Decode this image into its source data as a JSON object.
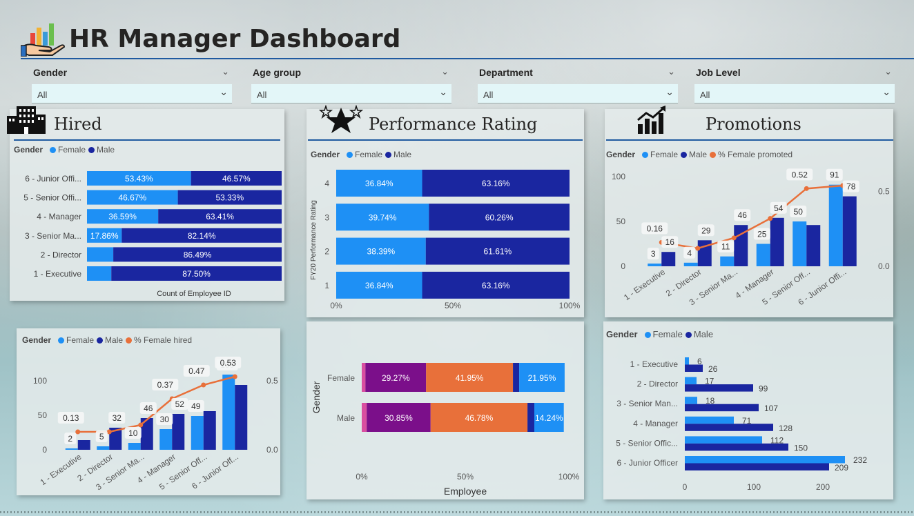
{
  "header": {
    "title": "HR Manager Dashboard"
  },
  "slicers": [
    {
      "label": "Gender",
      "value": "All"
    },
    {
      "label": "Age group",
      "value": "All"
    },
    {
      "label": "Department",
      "value": "All"
    },
    {
      "label": "Job Level",
      "value": "All"
    }
  ],
  "legend": {
    "gender": "Gender",
    "female": "Female",
    "male": "Male",
    "female_hired": "% Female hired",
    "female_promoted": "% Female promoted"
  },
  "colors": {
    "female": "#1e90f5",
    "male": "#1a26a0",
    "line": "#e8703a",
    "accent_rule": "#1f5aa0",
    "purple": "#7b0f8a",
    "pink": "#d94fa0"
  },
  "icons": [
    "chart-hand-icon",
    "building-icon",
    "stars-icon",
    "growth-chart-icon"
  ],
  "hired": {
    "title": "Hired",
    "xlabel": "Count of Employee ID"
  },
  "performance": {
    "title": "Performance Rating"
  },
  "promotions": {
    "title": "Promotions"
  },
  "chart_data": [
    {
      "id": "hired-stacked",
      "type": "bar",
      "orientation": "horizontal-100-stacked",
      "categories": [
        "6 - Junior Offi...",
        "5 - Senior Offi...",
        "4 - Manager",
        "3 - Senior Ma...",
        "2 - Director",
        "1 - Executive"
      ],
      "series": [
        {
          "name": "Female",
          "values": [
            53.43,
            46.67,
            36.59,
            17.86,
            13.51,
            12.5
          ],
          "labels": [
            "53.43%",
            "46.67%",
            "36.59%",
            "17.86%",
            "",
            ""
          ]
        },
        {
          "name": "Male",
          "values": [
            46.57,
            53.33,
            63.41,
            82.14,
            86.49,
            87.5
          ],
          "labels": [
            "46.57%",
            "53.33%",
            "63.41%",
            "82.14%",
            "86.49%",
            "87.50%"
          ]
        }
      ],
      "xlabel": "Count of Employee ID"
    },
    {
      "id": "hired-combo",
      "type": "bar",
      "categories": [
        "1 - Executive",
        "2 - Director",
        "3 - Senior Ma...",
        "4 - Manager",
        "5 - Senior Off...",
        "6 - Junior Off..."
      ],
      "series": [
        {
          "name": "Female",
          "values": [
            2,
            5,
            10,
            30,
            49,
            109
          ]
        },
        {
          "name": "Male",
          "values": [
            14,
            32,
            46,
            52,
            56,
            94
          ]
        },
        {
          "name": "% Female hired",
          "values": [
            0.13,
            0.13,
            0.18,
            0.37,
            0.47,
            0.53
          ],
          "axis": "right"
        }
      ],
      "value_labels": [
        {
          "series": "Female",
          "labels": [
            "2",
            "5",
            "10",
            "30",
            "49",
            "109"
          ]
        },
        {
          "series": "Male",
          "labels": [
            "",
            "32",
            "46",
            "52",
            "",
            ""
          ]
        },
        {
          "series": "% Female hired",
          "labels": [
            "0.13",
            "",
            "",
            "0.37",
            "0.47",
            "0.53"
          ]
        }
      ],
      "y_ticks": [
        "0",
        "50",
        "100"
      ],
      "y2_ticks": [
        "0.0",
        "0.5"
      ],
      "ylim": [
        0,
        130
      ],
      "y2lim": [
        0,
        0.65
      ]
    },
    {
      "id": "performance-rating",
      "type": "bar",
      "orientation": "horizontal-100-stacked",
      "categories": [
        "4",
        "3",
        "2",
        "1"
      ],
      "series": [
        {
          "name": "Female",
          "values": [
            36.84,
            39.74,
            38.39,
            36.84
          ],
          "labels": [
            "36.84%",
            "39.74%",
            "38.39%",
            "36.84%"
          ]
        },
        {
          "name": "Male",
          "values": [
            63.16,
            60.26,
            61.61,
            63.16
          ],
          "labels": [
            "63.16%",
            "60.26%",
            "61.61%",
            "63.16%"
          ]
        }
      ],
      "ylabel": "FY20 Performance Rating",
      "x_ticks": [
        "0%",
        "50%",
        "100%"
      ]
    },
    {
      "id": "employee-gender",
      "type": "bar",
      "orientation": "horizontal-100-stacked",
      "categories": [
        "Female",
        "Male"
      ],
      "series": [
        {
          "name": "Segment 1",
          "color": "#d94fa0",
          "values": [
            1.8,
            2.4
          ]
        },
        {
          "name": "Segment 2",
          "color": "#7b0f8a",
          "values": [
            29.27,
            30.85
          ],
          "labels": [
            "29.27%",
            "30.85%"
          ]
        },
        {
          "name": "Segment 3",
          "color": "#e8703a",
          "values": [
            41.95,
            46.78
          ],
          "labels": [
            "41.95%",
            "46.78%"
          ]
        },
        {
          "name": "Segment 4",
          "color": "#1a26a0",
          "values": [
            3.0,
            3.3
          ]
        },
        {
          "name": "Segment 5",
          "color": "#1e90f5",
          "values": [
            21.95,
            14.24
          ],
          "labels": [
            "21.95%",
            "14.24%"
          ]
        }
      ],
      "xlabel": "Employee",
      "ylabel": "Gender",
      "x_ticks": [
        "0%",
        "50%",
        "100%"
      ]
    },
    {
      "id": "promotions-combo",
      "type": "bar",
      "categories": [
        "1 - Executive",
        "2 - Director",
        "3 - Senior Ma...",
        "4 - Manager",
        "5 - Senior Off...",
        "6 - Junior Offi..."
      ],
      "series": [
        {
          "name": "Female",
          "values": [
            3,
            4,
            11,
            25,
            50,
            91
          ]
        },
        {
          "name": "Male",
          "values": [
            16,
            29,
            46,
            54,
            46,
            78
          ]
        },
        {
          "name": "% Female promoted",
          "values": [
            0.16,
            0.12,
            0.19,
            0.32,
            0.52,
            0.54
          ],
          "axis": "right"
        }
      ],
      "value_labels": [
        {
          "series": "Female",
          "labels": [
            "3",
            "4",
            "11",
            "25",
            "50",
            "91"
          ]
        },
        {
          "series": "Male",
          "labels": [
            "16",
            "29",
            "46",
            "54",
            "",
            "78"
          ]
        },
        {
          "series": "% Female promoted",
          "labels": [
            "0.16",
            "",
            "",
            "",
            "0.52",
            ""
          ]
        }
      ],
      "y_ticks": [
        "0",
        "50",
        "100"
      ],
      "y2_ticks": [
        "0.0",
        "0.5"
      ],
      "ylim": [
        0,
        100
      ],
      "y2lim": [
        0,
        0.6
      ]
    },
    {
      "id": "promotions-horizontal",
      "type": "bar",
      "orientation": "horizontal",
      "categories": [
        "1 - Executive",
        "2 - Director",
        "3 - Senior Man...",
        "4 - Manager",
        "5 - Senior Offic...",
        "6 - Junior Officer"
      ],
      "series": [
        {
          "name": "Female",
          "values": [
            6,
            17,
            18,
            71,
            112,
            232
          ]
        },
        {
          "name": "Male",
          "values": [
            26,
            99,
            107,
            128,
            150,
            209
          ]
        }
      ],
      "x_ticks": [
        "0",
        "100",
        "200"
      ],
      "xlim": [
        0,
        254
      ]
    }
  ]
}
